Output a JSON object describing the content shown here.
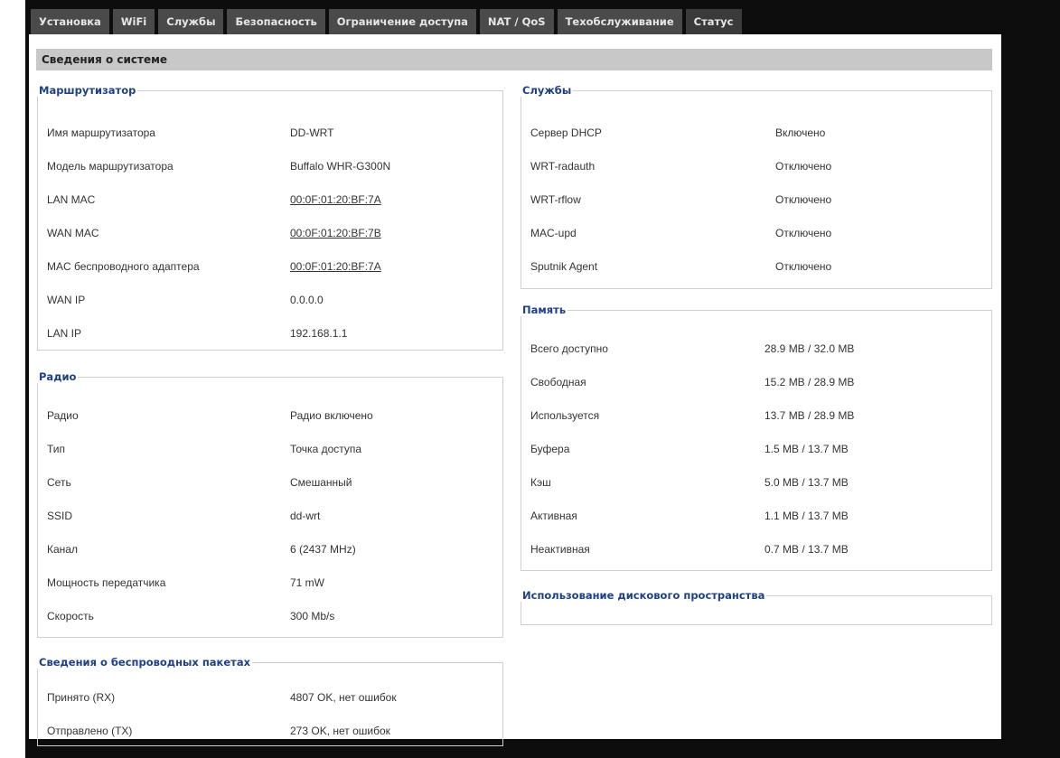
{
  "nav": {
    "tabs": [
      {
        "label": "Установка"
      },
      {
        "label": "WiFi"
      },
      {
        "label": "Службы"
      },
      {
        "label": "Безопасность"
      },
      {
        "label": "Ограничение доступа"
      },
      {
        "label": "NAT / QoS"
      },
      {
        "label": "Техобслуживание"
      },
      {
        "label": "Статус"
      }
    ]
  },
  "page_title": "Сведения о системе",
  "router": {
    "legend": "Маршрутизатор",
    "rows": [
      {
        "label": "Имя маршрутизатора",
        "value": "DD-WRT"
      },
      {
        "label": "Модель маршрутизатора",
        "value": "Buffalo WHR-G300N"
      },
      {
        "label": "LAN MAC",
        "value": "00:0F:01:20:BF:7A"
      },
      {
        "label": "WAN MAC",
        "value": "00:0F:01:20:BF:7B"
      },
      {
        "label": "MAC беспроводного адаптера",
        "value": "00:0F:01:20:BF:7A"
      },
      {
        "label": "WAN IP",
        "value": "0.0.0.0"
      },
      {
        "label": "LAN IP",
        "value": "192.168.1.1"
      }
    ]
  },
  "radio": {
    "legend": "Радио",
    "rows": [
      {
        "label": "Радио",
        "value": "Радио включено"
      },
      {
        "label": "Тип",
        "value": "Точка доступа"
      },
      {
        "label": "Сеть",
        "value": "Смешанный"
      },
      {
        "label": "SSID",
        "value": "dd-wrt"
      },
      {
        "label": "Канал",
        "value": "6 (2437 MHz)"
      },
      {
        "label": "Мощность передатчика",
        "value": "71 mW"
      },
      {
        "label": "Скорость",
        "value": "300 Mb/s"
      }
    ]
  },
  "packets": {
    "legend": "Сведения о беспроводных пакетах",
    "rows": [
      {
        "label": "Принято (RX)",
        "value": "4807 OK, нет ошибок"
      },
      {
        "label": "Отправлено (TX)",
        "value": "273 OK, нет ошибок"
      }
    ]
  },
  "services": {
    "legend": "Службы",
    "rows": [
      {
        "label": "Сервер DHCP",
        "value": "Включено"
      },
      {
        "label": "WRT-radauth",
        "value": "Отключено"
      },
      {
        "label": "WRT-rflow",
        "value": "Отключено"
      },
      {
        "label": "MAC-upd",
        "value": "Отключено"
      },
      {
        "label": "Sputnik Agent",
        "value": "Отключено"
      }
    ]
  },
  "memory": {
    "legend": "Память",
    "rows": [
      {
        "label": "Всего доступно",
        "value": "28.9 MB / 32.0 MB"
      },
      {
        "label": "Свободная",
        "value": "15.2 MB / 28.9 MB"
      },
      {
        "label": "Используется",
        "value": "13.7 MB / 28.9 MB"
      },
      {
        "label": "Буфера",
        "value": "1.5 MB / 13.7 MB"
      },
      {
        "label": "Кэш",
        "value": "5.0 MB / 13.7 MB"
      },
      {
        "label": "Активная",
        "value": "1.1 MB / 13.7 MB"
      },
      {
        "label": "Неактивная",
        "value": "0.7 MB / 13.7 MB"
      }
    ]
  },
  "disk": {
    "legend": "Использование дискового пространства"
  }
}
